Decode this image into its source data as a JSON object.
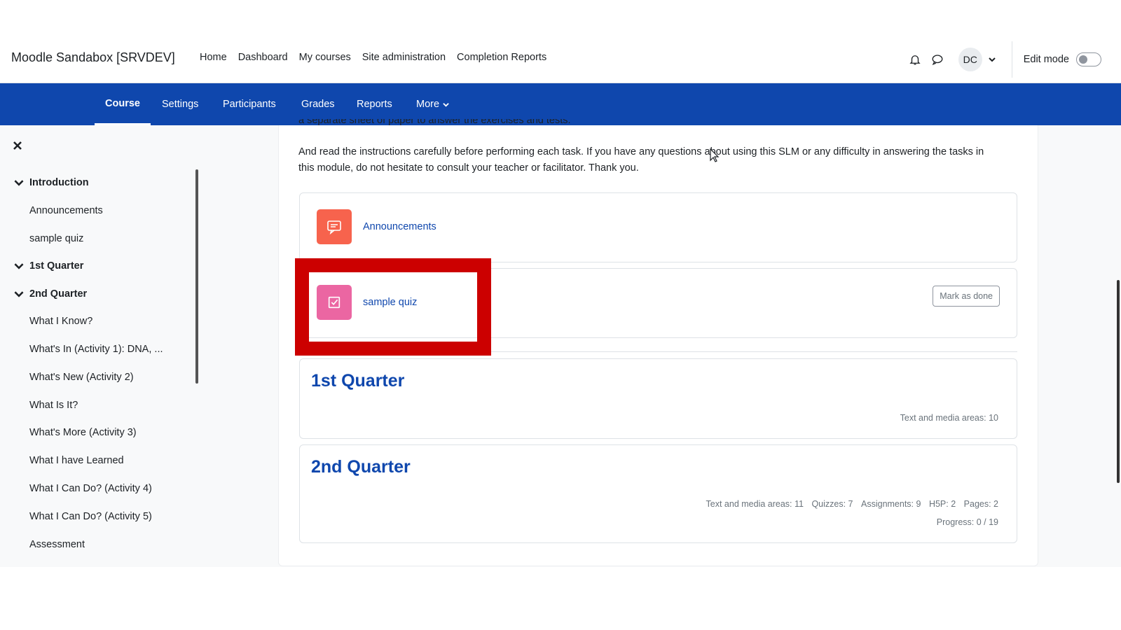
{
  "brand": "Moodle Sandabox [SRVDEV]",
  "primary_nav": [
    "Home",
    "Dashboard",
    "My courses",
    "Site administration",
    "Completion Reports"
  ],
  "user_initials": "DC",
  "edit_mode_label": "Edit mode",
  "secondary_nav": {
    "course": "Course",
    "settings": "Settings",
    "participants": "Participants",
    "grades": "Grades",
    "reports": "Reports",
    "more": "More"
  },
  "course_index": {
    "introduction": "Introduction",
    "announcements": "Announcements",
    "sample_quiz": "sample quiz",
    "quarter1": "1st Quarter",
    "quarter2": "2nd Quarter",
    "items": [
      "What I Know?",
      "What's In (Activity 1): DNA, ...",
      "What's New (Activity 2)",
      "What Is It?",
      "What's More (Activity 3)",
      "What I have Learned",
      "What I Can Do? (Activity 4)",
      "What I Can Do? (Activity 5)",
      "Assessment"
    ]
  },
  "main": {
    "cut_text": "a separate sheet of paper to answer the exercises and tests.",
    "intro_text": "And read the instructions carefully before performing each task. If you have any questions about using this SLM or any difficulty in answering the tasks in this module, do not hesitate to consult your teacher or facilitator. Thank you.",
    "activity_announcements": "Announcements",
    "activity_quiz": "sample quiz",
    "mark_as_done": "Mark as done",
    "section1": {
      "title": "1st Quarter",
      "stats": "Text and media areas: 10"
    },
    "section2": {
      "title": "2nd Quarter",
      "stat_text_media": "Text and media areas: 11",
      "stat_quizzes": "Quizzes: 7",
      "stat_assignments": "Assignments: 9",
      "stat_h5p": "H5P: 2",
      "stat_pages": "Pages: 2",
      "progress": "Progress: 0 / 19"
    }
  },
  "colors": {
    "brand_blue": "#0f47ad",
    "announcement_icon_bg": "#f7634d",
    "quiz_icon_bg": "#eb66a2",
    "highlight_red": "#cc0000"
  }
}
